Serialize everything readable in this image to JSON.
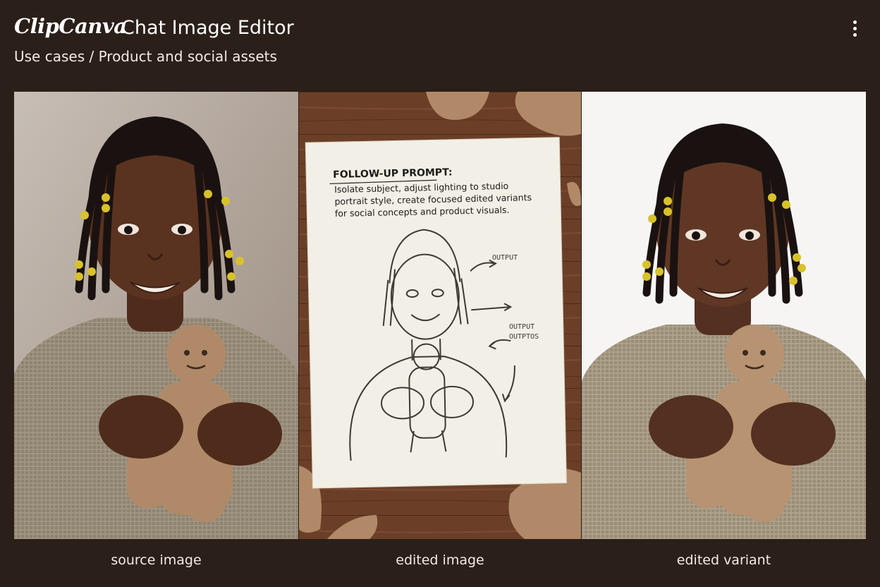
{
  "header": {
    "brand": "ClipCanva",
    "title": "Chat Image Editor",
    "breadcrumb": "Use cases / Product and social assets",
    "menu_icon": "more-vertical-icon"
  },
  "panels": [
    {
      "caption": "source image",
      "background": "#bdb4ac"
    },
    {
      "caption": "edited image",
      "background": "#6a3f28",
      "paper": {
        "heading": "FOLLOW-UP PROMPT:",
        "lines": [
          "Isolate subject, adjust lighting to studio",
          "portrait style, create focused edited variants",
          "for social concepts and product visuals."
        ],
        "annotations": [
          "OUTPUT",
          "OUTPUT",
          "OUTPTOS"
        ]
      }
    },
    {
      "caption": "edited variant",
      "background": "#f6f5f3"
    }
  ],
  "colors": {
    "page_bg": "#2a1f19",
    "text": "#f3ede6",
    "skin": "#5a3220",
    "shirt": "#8d8270",
    "clay": "#b08a68",
    "bead": "#d8c22a"
  }
}
